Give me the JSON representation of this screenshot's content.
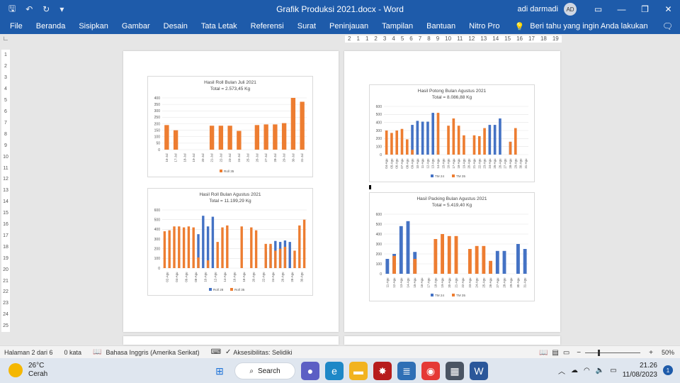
{
  "window": {
    "title": "Grafik Produksi 2021.docx  -  Word",
    "user": "adi darmadi",
    "avatar_initials": "AD",
    "quick_access": {
      "save_icon": "save-icon",
      "undo_icon": "undo-icon",
      "redo_icon": "redo-icon",
      "customize": "▾"
    },
    "controls": {
      "ribbon": "▭",
      "minimize": "—",
      "restore": "❐",
      "close": "✕"
    }
  },
  "menu": {
    "items": [
      "File",
      "Beranda",
      "Sisipkan",
      "Gambar",
      "Desain",
      "Tata Letak",
      "Referensi",
      "Surat",
      "Peninjauan",
      "Tampilan",
      "Bantuan",
      "Nitro Pro"
    ],
    "tell_me": "Beri tahu yang ingin Anda lakukan"
  },
  "ruler": {
    "corner": "∟",
    "h_ticks": [
      "2",
      "1",
      "1",
      "2",
      "3",
      "4",
      "5",
      "6",
      "7",
      "8",
      "9",
      "10",
      "11",
      "12",
      "13",
      "14",
      "15",
      "16",
      "17",
      "18",
      "19"
    ],
    "v_ticks": [
      "1",
      "2",
      "3",
      "4",
      "5",
      "6",
      "7",
      "8",
      "9",
      "10",
      "11",
      "12",
      "13",
      "14",
      "15",
      "16",
      "17",
      "18",
      "19",
      "20",
      "21",
      "22",
      "23",
      "24",
      "25"
    ]
  },
  "colors": {
    "accent": "#1e5baa",
    "series_blue": "#4472c4",
    "series_orange": "#ed7d31"
  },
  "chart_data": [
    {
      "type": "bar",
      "title": "Hasil Roll Bulan Juli 2021",
      "subtitle": "Total = 2.573,45 Kg",
      "categories": [
        "16-Jul",
        "17-Jul",
        "18-Jul",
        "19-Jul",
        "20-Jul",
        "21-Jul",
        "22-Jul",
        "23-Jul",
        "24-Jul",
        "25-Jul",
        "26-Jul",
        "27-Jul",
        "28-Jul",
        "29-Jul",
        "30-Jul",
        "31-Jul"
      ],
      "series": [
        {
          "name": "Roll 35",
          "values": [
            190,
            150,
            0,
            0,
            0,
            185,
            185,
            185,
            145,
            0,
            190,
            195,
            195,
            205,
            400,
            370
          ]
        }
      ],
      "ylim": [
        0,
        400
      ],
      "yticks": [
        "0",
        "50",
        "100",
        "150",
        "200",
        "250",
        "300",
        "350",
        "400"
      ],
      "legend": "bottom"
    },
    {
      "type": "bar",
      "title": "Hasil Roll Bulan Agustus 2021",
      "subtitle": "Total = 11.199,29 Kg",
      "categories": [
        "02-Agu",
        "04-Agu",
        "06-Agu",
        "08-Agu",
        "10-Agu",
        "12-Agu",
        "14-Agu",
        "16-Agu",
        "18-Agu",
        "20-Agu",
        "22-Agu",
        "24-Agu",
        "26-Agu",
        "28-Agu",
        "30-Agu"
      ],
      "series": [
        {
          "name": "Roll 28",
          "values": [
            0,
            0,
            0,
            0,
            0,
            0,
            0,
            350,
            540,
            430,
            530,
            0,
            0,
            0,
            0,
            0,
            0,
            0,
            0,
            0,
            0,
            170,
            230,
            280,
            270,
            285,
            270,
            0,
            0,
            0
          ]
        },
        {
          "name": "Roll 35",
          "values": [
            380,
            390,
            430,
            430,
            420,
            430,
            420,
            110,
            0,
            80,
            0,
            270,
            420,
            440,
            0,
            0,
            430,
            0,
            420,
            390,
            0,
            250,
            250,
            180,
            200,
            220,
            0,
            180,
            440,
            500
          ]
        }
      ],
      "ylim": [
        0,
        600
      ],
      "yticks": [
        "0",
        "100",
        "200",
        "300",
        "400",
        "500",
        "600"
      ],
      "legend": "bottom"
    },
    {
      "type": "bar",
      "title": "Hasil Potong Bulan Agustus 2021",
      "subtitle": "Total = 8.086,88 Kg",
      "categories": [
        "04-Agu",
        "05-Agu",
        "06-Agu",
        "07-Agu",
        "08-Agu",
        "09-Agu",
        "10-Agu",
        "11-Agu",
        "12-Agu",
        "13-Agu",
        "14-Agu",
        "15-Agu",
        "16-Agu",
        "17-Agu",
        "18-Agu",
        "19-Agu",
        "20-Agu",
        "21-Agu",
        "22-Agu",
        "23-Agu",
        "24-Agu",
        "25-Agu",
        "26-Agu",
        "27-Agu",
        "28-Agu",
        "29-Agu",
        "30-Agu",
        "31-Agu"
      ],
      "series": [
        {
          "name": "TM 24",
          "values": [
            0,
            0,
            0,
            0,
            0,
            370,
            420,
            410,
            410,
            520,
            50,
            0,
            0,
            0,
            0,
            0,
            0,
            0,
            0,
            0,
            370,
            370,
            450,
            0,
            160,
            0,
            0,
            0
          ]
        },
        {
          "name": "TM 35",
          "values": [
            300,
            270,
            300,
            320,
            190,
            60,
            0,
            0,
            0,
            0,
            520,
            0,
            360,
            450,
            360,
            240,
            0,
            240,
            230,
            330,
            0,
            0,
            0,
            0,
            160,
            330,
            0,
            0
          ]
        }
      ],
      "ylim": [
        0,
        600
      ],
      "yticks": [
        "0",
        "100",
        "200",
        "300",
        "400",
        "500",
        "600"
      ],
      "legend": "bottom"
    },
    {
      "type": "bar",
      "title": "Hasil Packing Bulan Agustus 2021",
      "subtitle": "Total = 5.419,40 Kg",
      "categories": [
        "11-Agu",
        "12-Agu",
        "13-Agu",
        "14-Agu",
        "15-Agu",
        "16-Agu",
        "17-Agu",
        "18-Agu",
        "19-Agu",
        "20-Agu",
        "21-Agu",
        "22-Agu",
        "23-Agu",
        "24-Agu",
        "25-Agu",
        "26-Agu",
        "27-Agu",
        "28-Agu",
        "29-Agu",
        "30-Agu",
        "31-Agu"
      ],
      "series": [
        {
          "name": "TM 24",
          "values": [
            150,
            200,
            480,
            530,
            220,
            0,
            0,
            0,
            0,
            0,
            0,
            0,
            0,
            0,
            0,
            80,
            230,
            230,
            0,
            300,
            250
          ]
        },
        {
          "name": "TM 35",
          "values": [
            0,
            180,
            0,
            0,
            150,
            0,
            0,
            350,
            400,
            380,
            380,
            0,
            250,
            280,
            280,
            130,
            0,
            0,
            0,
            0,
            0
          ]
        }
      ],
      "ylim": [
        0,
        600
      ],
      "yticks": [
        "0",
        "100",
        "200",
        "300",
        "400",
        "500",
        "600"
      ],
      "legend": "bottom"
    }
  ],
  "status": {
    "page": "Halaman 2 dari 6",
    "words": "0 kata",
    "language": "Bahasa Inggris (Amerika Serikat)",
    "accessibility": "Aksesibilitas: Selidiki",
    "zoom_minus": "−",
    "zoom_plus": "+",
    "zoom": "50%"
  },
  "taskbar": {
    "temperature": "26°C",
    "weather": "Cerah",
    "search": "Search",
    "time": "21.26",
    "date": "11/08/2023",
    "notifications": "1",
    "tray_chevron": "︿"
  }
}
